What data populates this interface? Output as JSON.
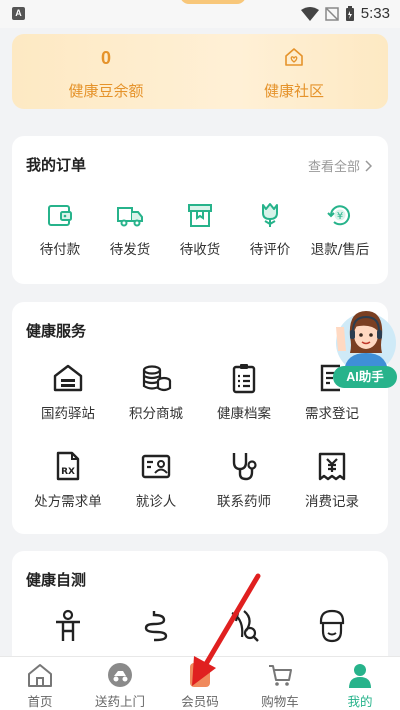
{
  "status": {
    "time": "5:33",
    "left_icon": "A"
  },
  "points": {
    "balance_value": "0",
    "balance_label": "健康豆余额",
    "community_label": "健康社区",
    "community_icon": "home-heart-icon",
    "accent_color": "#e5932b"
  },
  "orders": {
    "title": "我的订单",
    "view_all": "查看全部",
    "items": [
      {
        "label": "待付款",
        "icon": "wallet-icon"
      },
      {
        "label": "待发货",
        "icon": "truck-icon"
      },
      {
        "label": "待收货",
        "icon": "box-icon"
      },
      {
        "label": "待评价",
        "icon": "flower-icon"
      },
      {
        "label": "退款/售后",
        "icon": "refund-icon"
      }
    ]
  },
  "services": {
    "title": "健康服务",
    "items": [
      {
        "label": "国药驿站",
        "icon": "station-icon"
      },
      {
        "label": "积分商城",
        "icon": "coins-icon"
      },
      {
        "label": "健康档案",
        "icon": "clipboard-icon"
      },
      {
        "label": "需求登记",
        "icon": "register-icon"
      },
      {
        "label": "处方需求单",
        "icon": "prescription-icon"
      },
      {
        "label": "就诊人",
        "icon": "id-card-icon"
      },
      {
        "label": "联系药师",
        "icon": "stethoscope-icon"
      },
      {
        "label": "消费记录",
        "icon": "receipt-icon"
      }
    ]
  },
  "ai_assistant": {
    "label": "AI助手"
  },
  "self_test": {
    "title": "健康自测",
    "items": [
      {
        "icon": "body-icon"
      },
      {
        "icon": "intestine-icon"
      },
      {
        "icon": "leaf-search-icon"
      },
      {
        "icon": "face-icon"
      }
    ]
  },
  "tabs": [
    {
      "label": "首页",
      "icon": "home-icon"
    },
    {
      "label": "送药上门",
      "icon": "delivery-icon"
    },
    {
      "label": "会员码",
      "icon": "member-code-icon"
    },
    {
      "label": "购物车",
      "icon": "cart-icon"
    },
    {
      "label": "我的",
      "icon": "user-icon",
      "active": true
    }
  ],
  "colors": {
    "primary": "#27b38b",
    "background": "#f2f3f5",
    "annotation_arrow": "#e02020"
  }
}
